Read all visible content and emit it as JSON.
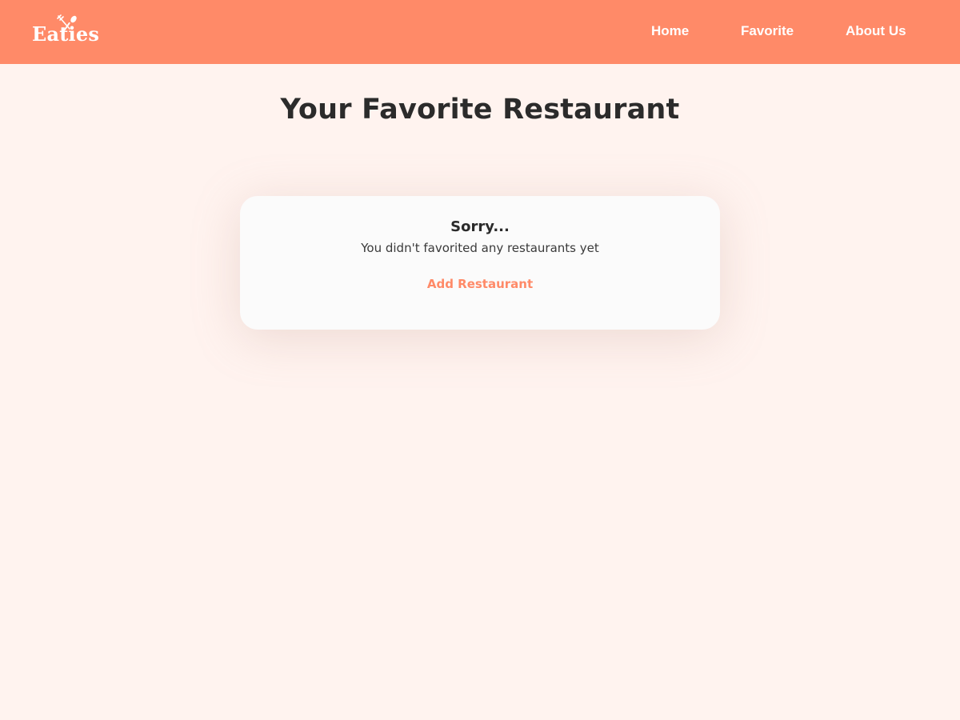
{
  "app": {
    "brand": "Eaties",
    "logo_icon": "fork-and-spoon-icon",
    "colors": {
      "header_bg": "#ff8a68",
      "page_bg": "#fff3ef",
      "card_bg": "#fbfbfb",
      "accent": "#ff8a68",
      "text_dark": "#2b2b2b"
    }
  },
  "nav": {
    "items": [
      {
        "label": "Home"
      },
      {
        "label": "Favorite"
      },
      {
        "label": "About Us"
      }
    ]
  },
  "main": {
    "title": "Your Favorite Restaurant",
    "empty_state": {
      "title": "Sorry...",
      "message": "You didn't favorited any restaurants yet",
      "action_label": "Add Restaurant"
    }
  }
}
